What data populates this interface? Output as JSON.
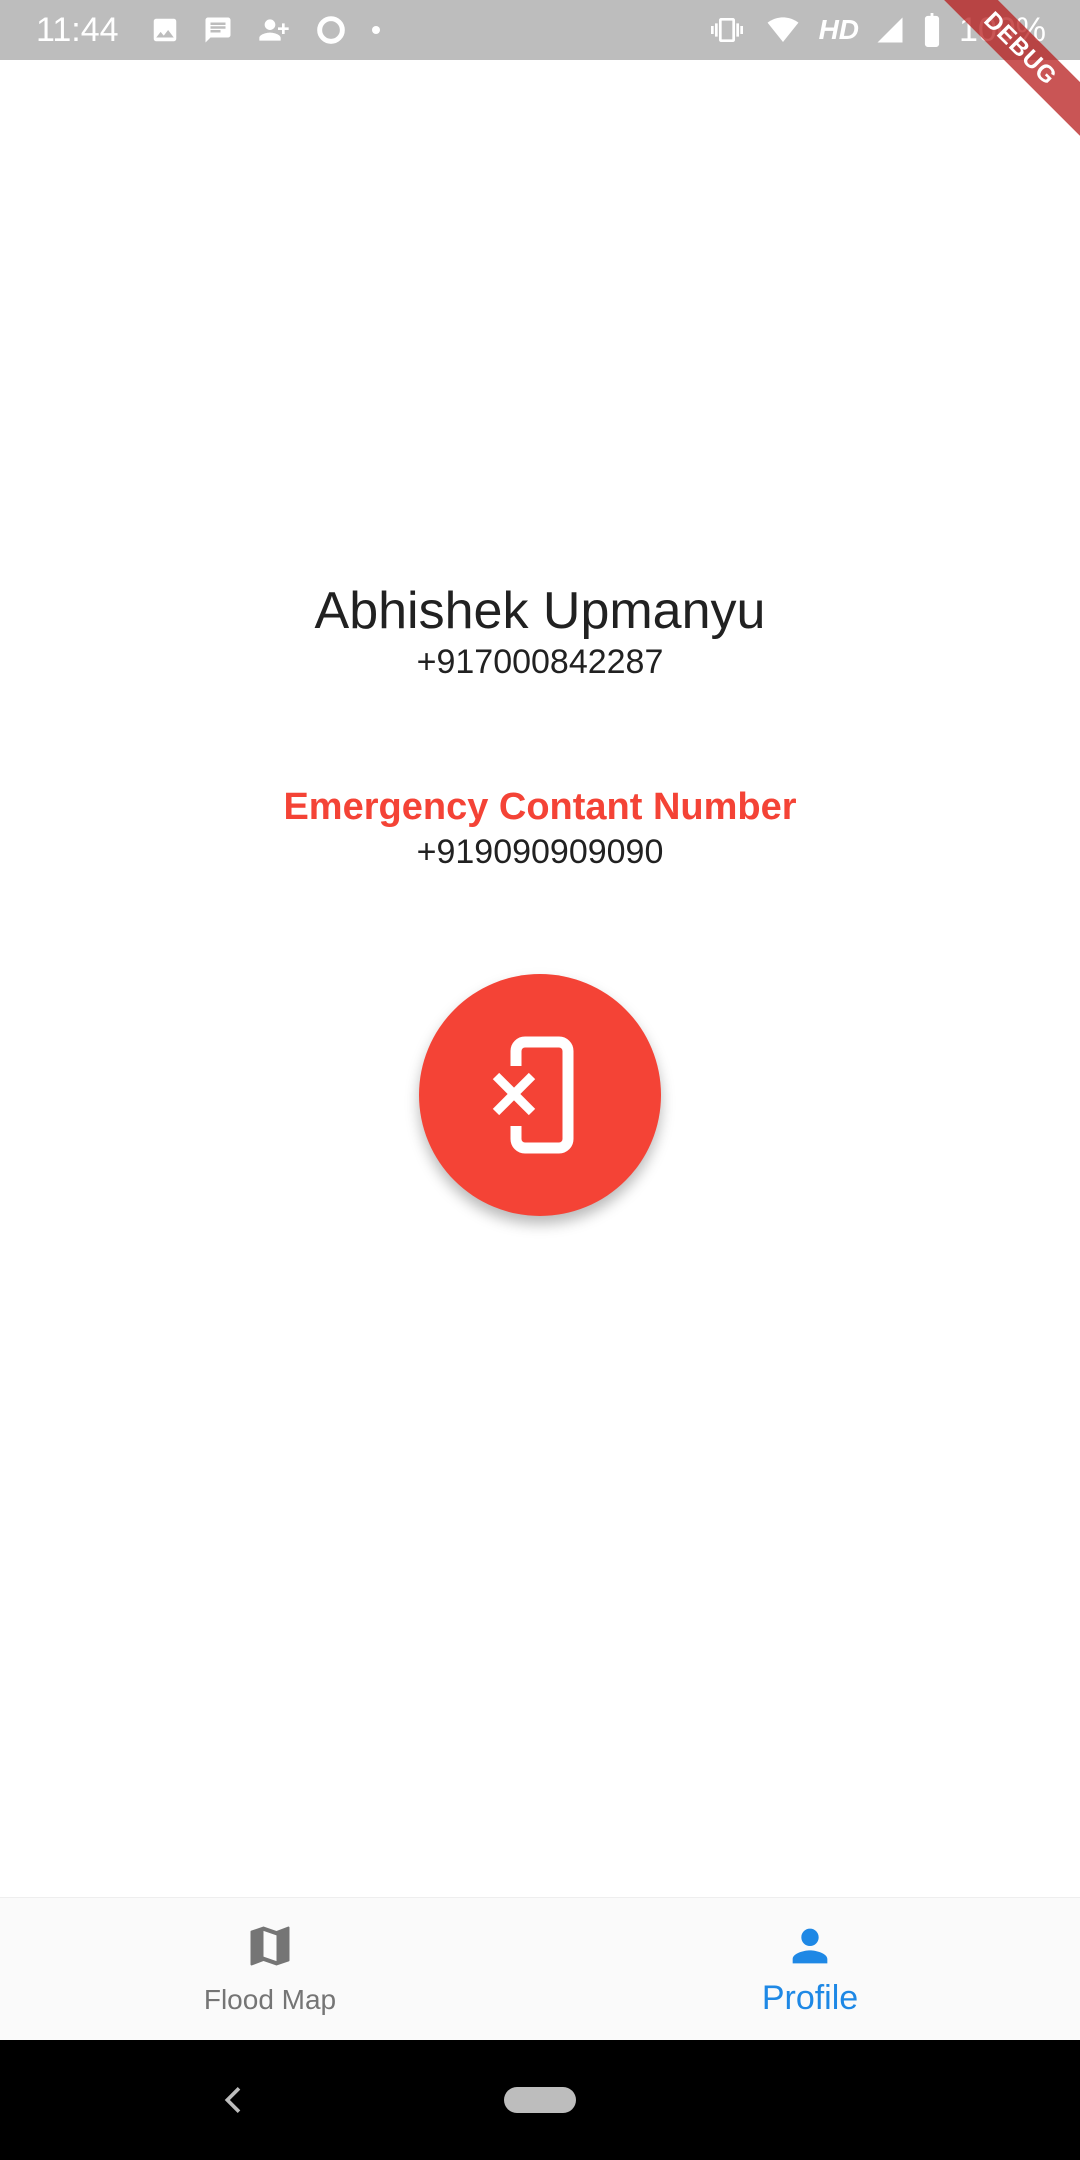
{
  "status_bar": {
    "time": "11:44",
    "network_label": "HD",
    "battery_text": "100%",
    "left_icons": [
      "image-icon",
      "message-icon",
      "add-contact-icon",
      "circle-icon",
      "dot-icon"
    ],
    "right_icons": [
      "vibrate-icon",
      "wifi-icon",
      "signal-icon",
      "battery-icon"
    ]
  },
  "debug_banner": {
    "label": "DEBUG"
  },
  "profile": {
    "name": "Abhishek Upmanyu",
    "phone": "+917000842287"
  },
  "emergency": {
    "label": "Emergency Contant Number",
    "phone": "+919090909090"
  },
  "action_button": {
    "icon": "phone-remove-icon",
    "color": "#f44336"
  },
  "bottom_nav": {
    "items": [
      {
        "label": "Flood Map",
        "icon": "map-icon",
        "active": false
      },
      {
        "label": "Profile",
        "icon": "person-icon",
        "active": true
      }
    ],
    "active_color": "#1e88e5",
    "inactive_color": "#757575"
  },
  "system_nav": {
    "icons": [
      "back-icon",
      "home-pill"
    ]
  }
}
